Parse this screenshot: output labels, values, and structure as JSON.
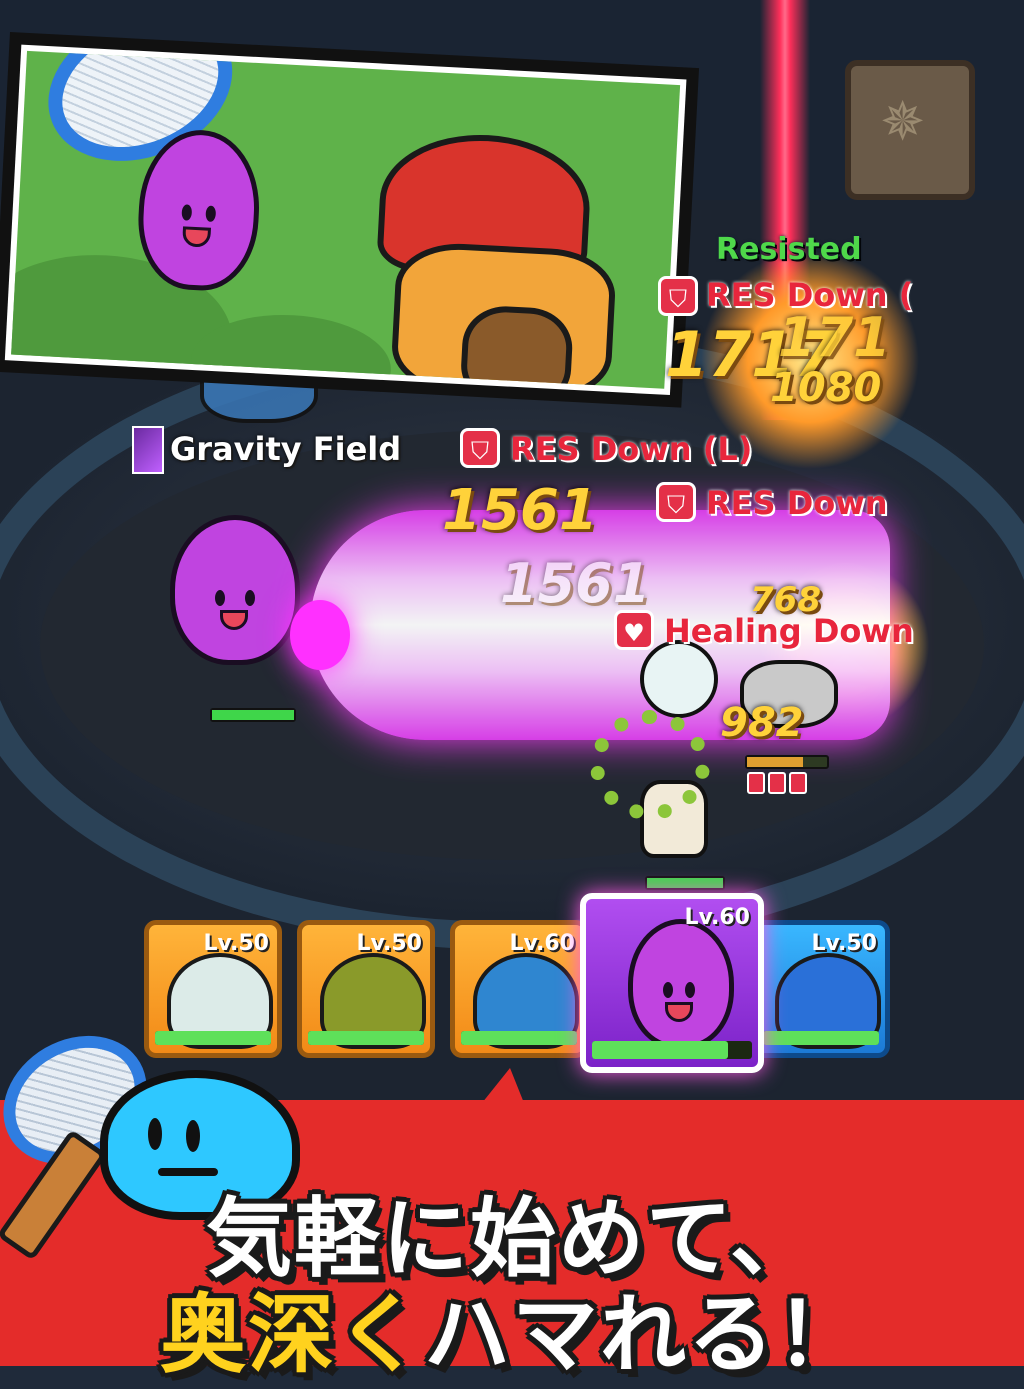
{
  "combat_text": {
    "resisted": "Resisted",
    "res_down_1": "RES Down (",
    "res_down_2": "RES Down (L)",
    "res_down_3": "RES Down",
    "healing_down": "Healing Down",
    "gravity_field": "Gravity Field",
    "dmg_a": "1717",
    "dmg_b": "171",
    "dmg_c": "1080",
    "dmg_d": "1561",
    "dmg_e": "1561",
    "dmg_f": "768",
    "dmg_g": "982"
  },
  "party": [
    {
      "level": "Lv.50",
      "color": "orange",
      "hp": 1.0
    },
    {
      "level": "Lv.50",
      "color": "orange",
      "hp": 1.0
    },
    {
      "level": "Lv.60",
      "color": "orange",
      "hp": 1.0
    },
    {
      "level": "Lv.60",
      "color": "purple",
      "hp": 0.85,
      "selected": true
    },
    {
      "level": "Lv.50",
      "color": "blue",
      "hp": 1.0
    }
  ],
  "headline": {
    "line1": "気軽に始めて、",
    "line2_accent": "奥深く",
    "line2_rest": "ハマれる！"
  },
  "colors": {
    "beam": "#e040f0",
    "banner_red": "#e42c2a",
    "headline_accent": "#ffd21e",
    "debuff_red": "#e8263c",
    "resisted_green": "#4fd84a"
  }
}
